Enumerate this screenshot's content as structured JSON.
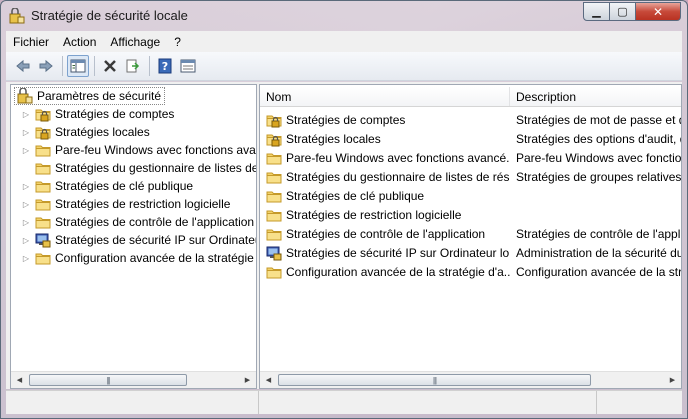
{
  "window": {
    "title": "Stratégie de sécurité locale",
    "controls": {
      "minimize": "▁",
      "maximize": "▢",
      "close": "✕"
    }
  },
  "menu": [
    "Fichier",
    "Action",
    "Affichage",
    "?"
  ],
  "toolbar": {
    "buttons": [
      "back-arrow-icon",
      "forward-arrow-icon",
      "show-hide-tree-icon",
      "delete-icon",
      "export-list-icon",
      "help-icon",
      "properties-icon"
    ]
  },
  "tree": {
    "root": "Paramètres de sécurité",
    "items": [
      {
        "label": "Stratégies de comptes",
        "icon": "lock-folder-icon",
        "expandable": true
      },
      {
        "label": "Stratégies locales",
        "icon": "lock-folder-icon",
        "expandable": true
      },
      {
        "label": "Pare-feu Windows avec fonctions ava",
        "icon": "folder-icon",
        "expandable": true
      },
      {
        "label": "Stratégies du gestionnaire de listes de",
        "icon": "folder-icon",
        "expandable": false
      },
      {
        "label": "Stratégies de clé publique",
        "icon": "folder-icon",
        "expandable": true
      },
      {
        "label": "Stratégies de restriction logicielle",
        "icon": "folder-icon",
        "expandable": true
      },
      {
        "label": "Stratégies de contrôle de l'application",
        "icon": "folder-icon",
        "expandable": true
      },
      {
        "label": "Stratégies de sécurité IP sur Ordinateu",
        "icon": "ipsec-icon",
        "expandable": true
      },
      {
        "label": "Configuration avancée de la stratégie",
        "icon": "folder-icon",
        "expandable": true
      }
    ]
  },
  "list": {
    "columns": {
      "name": "Nom",
      "description": "Description"
    },
    "rows": [
      {
        "name": "Stratégies de comptes",
        "description": "Stratégies de mot de passe et de",
        "icon": "lock-folder-icon"
      },
      {
        "name": "Stratégies locales",
        "description": "Stratégies des options d'audit, d",
        "icon": "lock-folder-icon"
      },
      {
        "name": "Pare-feu Windows avec fonctions avancé...",
        "description": "Pare-feu Windows avec fonctio",
        "icon": "folder-icon"
      },
      {
        "name": "Stratégies du gestionnaire de listes de rés...",
        "description": "Stratégies de groupes relatives a",
        "icon": "folder-icon"
      },
      {
        "name": "Stratégies de clé publique",
        "description": "",
        "icon": "folder-icon"
      },
      {
        "name": "Stratégies de restriction logicielle",
        "description": "",
        "icon": "folder-icon"
      },
      {
        "name": "Stratégies de contrôle de l'application",
        "description": "Stratégies de contrôle de l'appli",
        "icon": "folder-icon"
      },
      {
        "name": "Stratégies de sécurité IP sur Ordinateur lo...",
        "description": "Administration de la sécurité du",
        "icon": "ipsec-icon"
      },
      {
        "name": "Configuration avancée de la stratégie d'a...",
        "description": "Configuration avancée de la str",
        "icon": "folder-icon"
      }
    ]
  },
  "scrollbar": {
    "left_arrow": "◀",
    "right_arrow": "▶",
    "grip": "|||"
  }
}
